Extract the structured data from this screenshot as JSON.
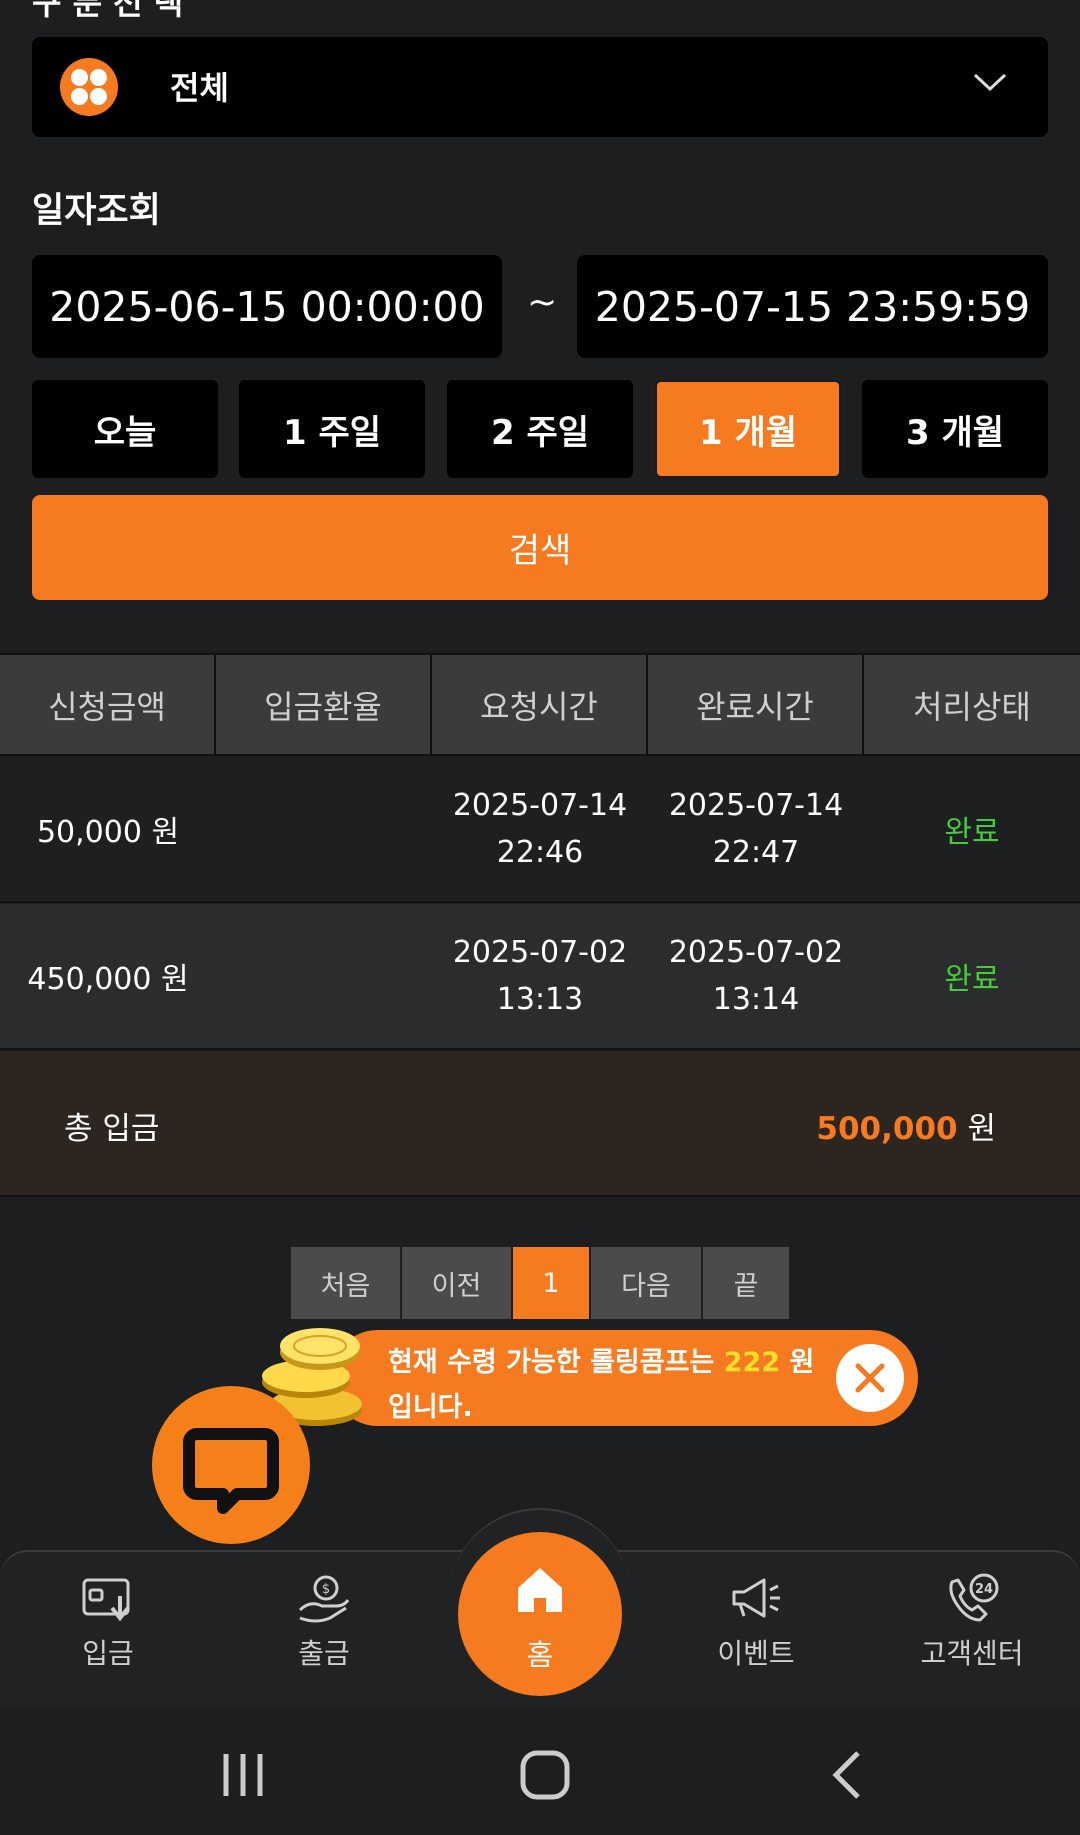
{
  "filter": {
    "type_label": "전체",
    "date_section_label": "일자조회",
    "date_from": "2025-06-15 00:00:00",
    "date_separator": "~",
    "date_to": "2025-07-15 23:59:59",
    "periods": [
      "오늘",
      "1 주일",
      "2 주일",
      "1 개월",
      "3 개월"
    ],
    "active_period": "1 개월",
    "search_label": "검색"
  },
  "table": {
    "headers": [
      "신청금액",
      "입금환율",
      "요청시간",
      "완료시간",
      "처리상태"
    ],
    "rows": [
      {
        "amount": "50,000 원",
        "rate": "",
        "request_date": "2025-07-14",
        "request_time": "22:46",
        "complete_date": "2025-07-14",
        "complete_time": "22:47",
        "status": "완료"
      },
      {
        "amount": "450,000 원",
        "rate": "",
        "request_date": "2025-07-02",
        "request_time": "13:13",
        "complete_date": "2025-07-02",
        "complete_time": "13:14",
        "status": "완료"
      }
    ],
    "total_label": "총 입금",
    "total_amount": "500,000",
    "total_unit": "원"
  },
  "pagination": {
    "first": "처음",
    "prev": "이전",
    "current": "1",
    "next": "다음",
    "last": "끝"
  },
  "comp_banner": {
    "text_before": "현재 수령 가능한 롤링콤프는",
    "amount": "222",
    "text_unit": "원",
    "text_after": "입니다."
  },
  "bottom_nav": {
    "deposit": "입금",
    "withdraw": "출금",
    "home": "홈",
    "event": "이벤트",
    "support": "고객센터"
  },
  "colors": {
    "accent": "#f57a20",
    "status_done": "#47c93c",
    "comp_amount": "#ffdf2a",
    "background": "#1c1e20"
  }
}
